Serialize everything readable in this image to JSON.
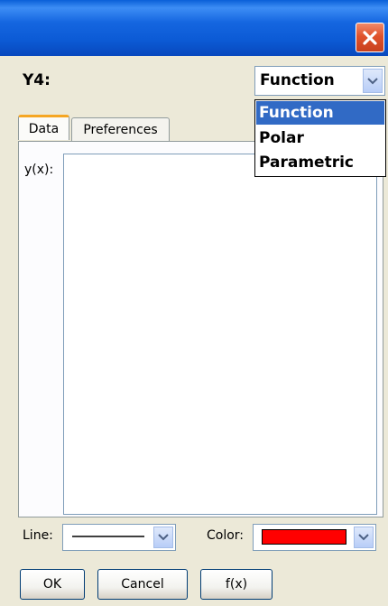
{
  "window": {
    "close_icon": "close-x-icon"
  },
  "header": {
    "label": "Y4:"
  },
  "type_select": {
    "selected": "Function",
    "options": [
      "Function",
      "Polar",
      "Parametric"
    ]
  },
  "tabs": [
    {
      "label": "Data",
      "active": true
    },
    {
      "label": "Preferences",
      "active": false
    }
  ],
  "data_tab": {
    "expr_label": "y(x):",
    "expr_value": ""
  },
  "line": {
    "label": "Line:",
    "style": "solid"
  },
  "color": {
    "label": "Color:",
    "swatch": "#ff0000"
  },
  "buttons": {
    "ok": "OK",
    "cancel": "Cancel",
    "fx": "f(x)"
  },
  "colors": {
    "title_bar": "#0c5bd6",
    "close_button": "#e0532c",
    "selection": "#316ac5",
    "active_tab_accent": "#f5a623"
  }
}
